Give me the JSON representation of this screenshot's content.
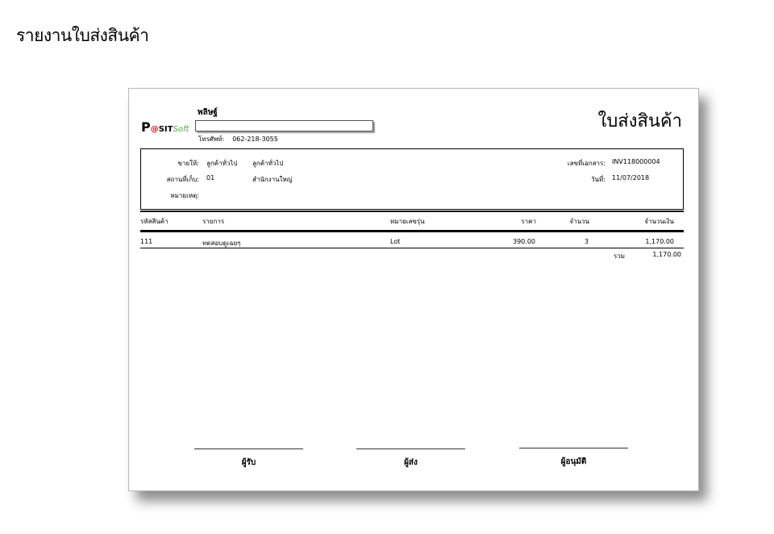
{
  "page": {
    "heading": "รายงานใบส่งสินค้า"
  },
  "logo": {
    "p": "P",
    "at": "@",
    "sit": "SIT",
    "soft": "Soft"
  },
  "company": {
    "name": "พลิษฐ์",
    "phone_label": "โทรศัพท์:",
    "phone_value": "062-218-3055"
  },
  "document": {
    "title": "ใบส่งสินค้า"
  },
  "info": {
    "sold_to_label": "ขายให้:",
    "sold_to_code": "ลูกค้าทั่วไป",
    "sold_to_name": "ลูกค้าทั่วไป",
    "warehouse_label": "สถานที่เก็บ:",
    "warehouse_code": "01",
    "warehouse_name": "สำนักงานใหญ่",
    "remark_label": "หมายเหตุ:",
    "doc_no_label": "เลขที่เอกสาร:",
    "doc_no_value": "INV118000004",
    "date_label": "วันที่:",
    "date_value": "11/07/2018"
  },
  "table": {
    "headers": {
      "code": "รหัสสินค้า",
      "item": "รายการ",
      "lot": "หมายเลขรุ่น",
      "price": "ราคา",
      "qty": "จำนวน",
      "amount": "จำนวนเงิน"
    },
    "rows": [
      {
        "code": "111",
        "item": "ทดสอบดูเฉยๆ",
        "lot": "Lot",
        "price": "390.00",
        "qty": "3",
        "amount": "1,170.00"
      }
    ],
    "total_label": "รวม",
    "total_value": "1,170.00"
  },
  "signatures": {
    "receiver": "ผู้รับ",
    "sender": "ผู้ส่ง",
    "approver": "ผู้อนุมัติ"
  }
}
